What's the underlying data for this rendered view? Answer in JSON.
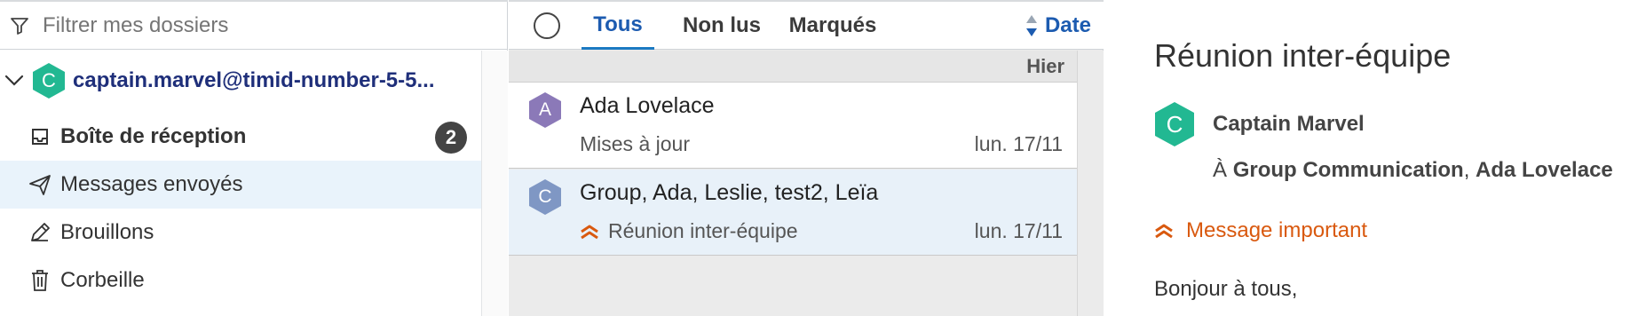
{
  "colors": {
    "accent_blue": "#1c5bb0",
    "teal_avatar": "#22b892",
    "purple_avatar": "#8b79b8",
    "steel_avatar": "#7f97c4",
    "important_orange": "#d9590f",
    "selection_bg": "#e9f3fb"
  },
  "sidebar": {
    "filter_placeholder": "Filtrer mes dossiers",
    "account": {
      "initial": "C",
      "name": "captain.marvel@timid-number-5-5..."
    },
    "folders": [
      {
        "label": "Boîte de réception",
        "icon": "inbox-icon",
        "badge": "2"
      },
      {
        "label": "Messages envoyés",
        "icon": "paper-plane-icon"
      },
      {
        "label": "Brouillons",
        "icon": "pencil-icon"
      },
      {
        "label": "Corbeille",
        "icon": "trash-icon"
      }
    ]
  },
  "message_list": {
    "tabs": [
      {
        "label": "Tous"
      },
      {
        "label": "Non lus"
      },
      {
        "label": "Marqués"
      }
    ],
    "sort_label": "Date",
    "group_label": "Hier",
    "messages": [
      {
        "initial": "A",
        "sender": "Ada Lovelace",
        "subject": "Mises à jour",
        "date": "lun. 17/11",
        "important": false
      },
      {
        "initial": "C",
        "sender": "Group, Ada, Leslie, test2, Leïa",
        "subject": "Réunion inter-équipe",
        "date": "lun. 17/11",
        "important": true
      }
    ]
  },
  "reading_pane": {
    "title": "Réunion inter-équipe",
    "from_initial": "C",
    "from_name": "Captain Marvel",
    "to_prefix": "À",
    "to_1": "Group Communication",
    "to_separator": ", ",
    "to_2": "Ada Lovelace",
    "important_label": "Message important",
    "body_start": "Bonjour à tous,"
  }
}
